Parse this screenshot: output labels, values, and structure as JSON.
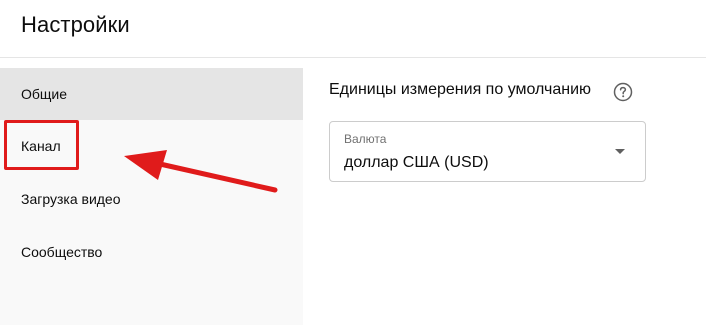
{
  "header": {
    "title": "Настройки"
  },
  "sidebar": {
    "items": [
      {
        "label": "Общие",
        "active": true
      },
      {
        "label": "Канал",
        "active": false
      },
      {
        "label": "Загрузка видео",
        "active": false
      },
      {
        "label": "Сообщество",
        "active": false
      }
    ]
  },
  "main": {
    "section_title": "Единицы измерения по умолчанию",
    "help_icon": "help-circle-icon",
    "currency_select": {
      "label": "Валюта",
      "value": "доллар США (USD)",
      "icon": "chevron-down-icon"
    }
  },
  "annotation": {
    "color": "#e01b1b"
  }
}
